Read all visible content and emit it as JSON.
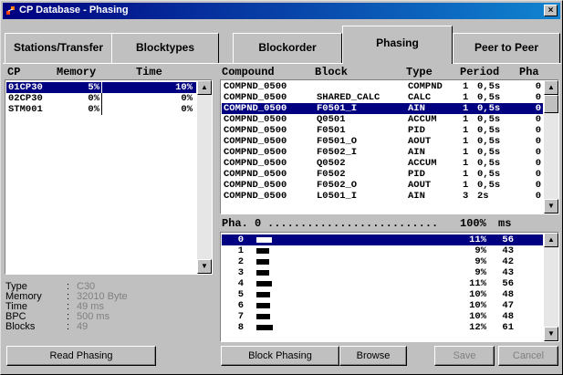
{
  "window": {
    "title": "CP Database - Phasing",
    "close": "×"
  },
  "tabs": [
    "Stations/Transfer",
    "Blocktypes",
    "Blockorder",
    "Phasing",
    "Peer to Peer"
  ],
  "active_tab": "Phasing",
  "left": {
    "headers": {
      "cp": "CP",
      "memory": "Memory",
      "time": "Time"
    },
    "rows": [
      {
        "cp": "01CP30",
        "memory": "5%",
        "time": "10%",
        "selected": true
      },
      {
        "cp": "02CP30",
        "memory": "0%",
        "time": "0%"
      },
      {
        "cp": "STM001",
        "memory": "0%",
        "time": "0%"
      }
    ],
    "info": [
      {
        "label": "Type",
        "value": "C30"
      },
      {
        "label": "Memory",
        "value": "32010 Byte"
      },
      {
        "label": "Time",
        "value": "49 ms"
      },
      {
        "label": "BPC",
        "value": "500 ms"
      },
      {
        "label": "Blocks",
        "value": "49"
      }
    ],
    "read_button": "Read Phasing"
  },
  "right": {
    "headers": {
      "compound": "Compound",
      "block": "Block",
      "type": "Type",
      "period": "Period",
      "pha": "Pha"
    },
    "rows": [
      {
        "compound": "COMPND_0500",
        "block": "",
        "type": "COMPND",
        "per1": "1",
        "per2": "0,5s",
        "pha": "0"
      },
      {
        "compound": "COMPND_0500",
        "block": "SHARED_CALC",
        "type": "CALC",
        "per1": "1",
        "per2": "0,5s",
        "pha": "0"
      },
      {
        "compound": "COMPND_0500",
        "block": "F0501_I",
        "type": "AIN",
        "per1": "1",
        "per2": "0,5s",
        "pha": "0",
        "selected": true
      },
      {
        "compound": "COMPND_0500",
        "block": "Q0501",
        "type": "ACCUM",
        "per1": "1",
        "per2": "0,5s",
        "pha": "0"
      },
      {
        "compound": "COMPND_0500",
        "block": "F0501",
        "type": "PID",
        "per1": "1",
        "per2": "0,5s",
        "pha": "0"
      },
      {
        "compound": "COMPND_0500",
        "block": "F0501_O",
        "type": "AOUT",
        "per1": "1",
        "per2": "0,5s",
        "pha": "0"
      },
      {
        "compound": "COMPND_0500",
        "block": "F0502_I",
        "type": "AIN",
        "per1": "1",
        "per2": "0,5s",
        "pha": "0"
      },
      {
        "compound": "COMPND_0500",
        "block": "Q0502",
        "type": "ACCUM",
        "per1": "1",
        "per2": "0,5s",
        "pha": "0"
      },
      {
        "compound": "COMPND_0500",
        "block": "F0502",
        "type": "PID",
        "per1": "1",
        "per2": "0,5s",
        "pha": "0"
      },
      {
        "compound": "COMPND_0500",
        "block": "F0502_O",
        "type": "AOUT",
        "per1": "1",
        "per2": "0,5s",
        "pha": "0"
      },
      {
        "compound": "COMPND_0500",
        "block": "L0501_I",
        "type": "AIN",
        "per1": "3",
        "per2": "2s",
        "pha": "0"
      }
    ],
    "pha_header": {
      "left": "Pha. 0",
      "dots": "..........................",
      "pct": "100%",
      "unit": "ms"
    },
    "phases": [
      {
        "n": "0",
        "pct": "11%",
        "ms": "56",
        "fill": 0.11,
        "selected": true
      },
      {
        "n": "1",
        "pct": "9%",
        "ms": "43",
        "fill": 0.09
      },
      {
        "n": "2",
        "pct": "9%",
        "ms": "42",
        "fill": 0.09
      },
      {
        "n": "3",
        "pct": "9%",
        "ms": "43",
        "fill": 0.09
      },
      {
        "n": "4",
        "pct": "11%",
        "ms": "56",
        "fill": 0.11
      },
      {
        "n": "5",
        "pct": "10%",
        "ms": "48",
        "fill": 0.1
      },
      {
        "n": "6",
        "pct": "10%",
        "ms": "47",
        "fill": 0.1
      },
      {
        "n": "7",
        "pct": "10%",
        "ms": "48",
        "fill": 0.1
      },
      {
        "n": "8",
        "pct": "12%",
        "ms": "61",
        "fill": 0.12
      }
    ],
    "buttons": {
      "block_phasing": "Block Phasing",
      "browse": "Browse",
      "save": "Save",
      "cancel": "Cancel"
    }
  },
  "colors": {
    "title_start": "#000080",
    "title_end": "#1084d0",
    "selection": "#000080",
    "face": "#c0c0c0"
  }
}
